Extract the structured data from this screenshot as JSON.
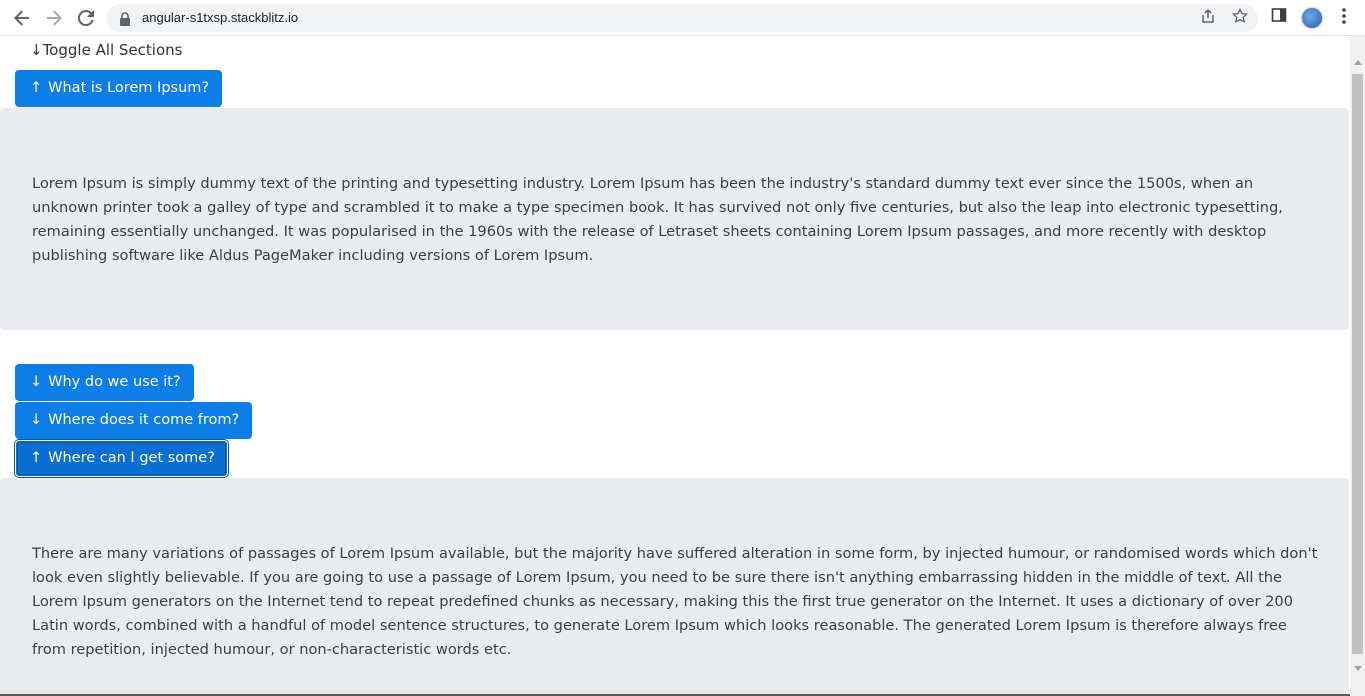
{
  "browser": {
    "url": "angular-s1txsp.stackblitz.io",
    "back_icon": "arrow-left-icon",
    "forward_icon": "arrow-right-icon",
    "reload_icon": "reload-icon"
  },
  "page": {
    "toggle_all_label": "↓Toggle All Sections",
    "sections": [
      {
        "arrow": "↑",
        "title": "What is Lorem Ipsum?",
        "expanded": true,
        "content": "Lorem Ipsum is simply dummy text of the printing and typesetting industry. Lorem Ipsum has been the industry's standard dummy text ever since the 1500s, when an unknown printer took a galley of type and scrambled it to make a type specimen book. It has survived not only five centuries, but also the leap into electronic typesetting, remaining essentially unchanged. It was popularised in the 1960s with the release of Letraset sheets containing Lorem Ipsum passages, and more recently with desktop publishing software like Aldus PageMaker including versions of Lorem Ipsum."
      },
      {
        "arrow": "↓",
        "title": "Why do we use it?",
        "expanded": false
      },
      {
        "arrow": "↓",
        "title": "Where does it come from?",
        "expanded": false
      },
      {
        "arrow": "↑",
        "title": "Where can I get some?",
        "expanded": true,
        "content": "There are many variations of passages of Lorem Ipsum available, but the majority have suffered alteration in some form, by injected humour, or randomised words which don't look even slightly believable. If you are going to use a passage of Lorem Ipsum, you need to be sure there isn't anything embarrassing hidden in the middle of text. All the Lorem Ipsum generators on the Internet tend to repeat predefined chunks as necessary, making this the first true generator on the Internet. It uses a dictionary of over 200 Latin words, combined with a handful of model sentence structures, to generate Lorem Ipsum which looks reasonable. The generated Lorem Ipsum is therefore always free from repetition, injected humour, or non-characteristic words etc."
      }
    ]
  },
  "colors": {
    "button_bg": "#0d7de8",
    "panel_bg": "#e9ebef",
    "text": "#3a3f45"
  }
}
